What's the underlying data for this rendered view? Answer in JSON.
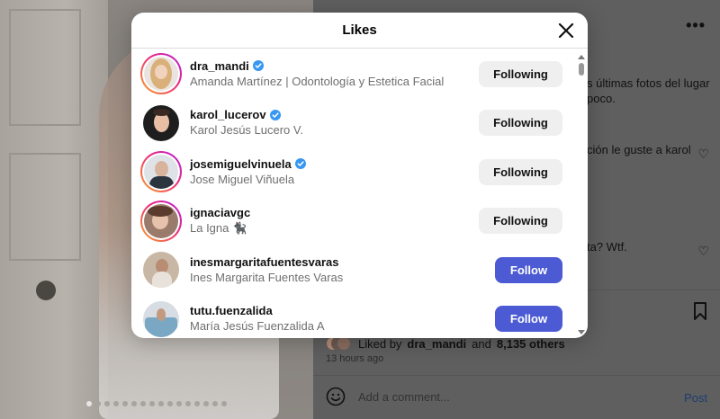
{
  "modal": {
    "title": "Likes",
    "users": [
      {
        "username": "dra_mandi",
        "full_name": "Amanda Martínez | Odontología y Estetica Facial",
        "verified": true,
        "story": true,
        "button": "Following"
      },
      {
        "username": "karol_lucerov",
        "full_name": "Karol Jesús Lucero V.",
        "verified": true,
        "story": false,
        "button": "Following"
      },
      {
        "username": "josemiguelvinuela",
        "full_name": "Jose Miguel Viñuela",
        "verified": true,
        "story": true,
        "button": "Following"
      },
      {
        "username": "ignaciavgc",
        "full_name": "La Igna 🐈‍⬛",
        "verified": false,
        "story": true,
        "button": "Following"
      },
      {
        "username": "inesmargaritafuentesvaras",
        "full_name": "Ines Margarita Fuentes Varas",
        "verified": false,
        "story": false,
        "button": "Follow"
      },
      {
        "username": "tutu.fuenzalida",
        "full_name": "María Jesús Fuenzalida A",
        "verified": false,
        "story": false,
        "button": "Follow"
      }
    ]
  },
  "background_post": {
    "caption_fragment_1": "s últimas fotos del lugar",
    "caption_fragment_2": "poco.",
    "comment_fragment_1": "ción le guste a karol",
    "comment_fragment_2": "ta? Wtf.",
    "liked_by_prefix": "Liked by",
    "liked_by_user": "dra_mandi",
    "liked_by_and": "and",
    "liked_by_count": "8,135 others",
    "time_ago": "13 hours ago",
    "comment_placeholder": "Add a comment...",
    "post_label": "Post"
  },
  "colors": {
    "follow_button": "#4c5bd4",
    "following_button": "#efefef",
    "verified_badge": "#3897f0"
  }
}
